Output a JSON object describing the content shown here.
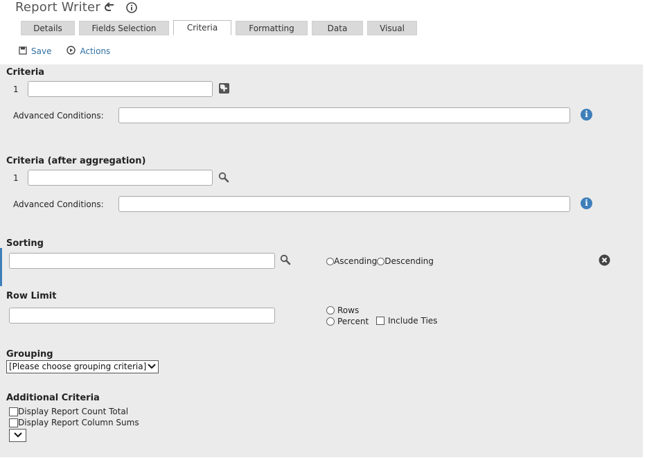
{
  "app": {
    "title": "Report Writer"
  },
  "tabs": [
    {
      "label": "Details"
    },
    {
      "label": "Fields Selection"
    },
    {
      "label": "Criteria"
    },
    {
      "label": "Formatting"
    },
    {
      "label": "Data"
    },
    {
      "label": "Visual"
    }
  ],
  "active_tab": "Criteria",
  "toolbar": {
    "save_label": "Save",
    "actions_label": "Actions"
  },
  "criteria": {
    "title": "Criteria",
    "row_number": "1",
    "value": "",
    "advanced_label": "Advanced Conditions:",
    "advanced_value": ""
  },
  "criteria_agg": {
    "title": "Criteria (after aggregation)",
    "row_number": "1",
    "value": "",
    "advanced_label": "Advanced Conditions:",
    "advanced_value": ""
  },
  "sorting": {
    "title": "Sorting",
    "value": "",
    "ascending_label": "Ascending",
    "descending_label": "Descending"
  },
  "row_limit": {
    "title": "Row Limit",
    "value": "",
    "rows_label": "Rows",
    "percent_label": "Percent",
    "include_ties_label": "Include Ties"
  },
  "grouping": {
    "title": "Grouping",
    "selected": "[Please choose grouping criteria]"
  },
  "additional": {
    "title": "Additional Criteria",
    "count_total_label": "Display Report Count Total",
    "column_sums_label": "Display Report Column Sums",
    "select_value": ""
  },
  "colors": {
    "accent": "#2f6fa1",
    "panel_bg": "#ebebeb",
    "info_blue": "#3e7fba"
  }
}
